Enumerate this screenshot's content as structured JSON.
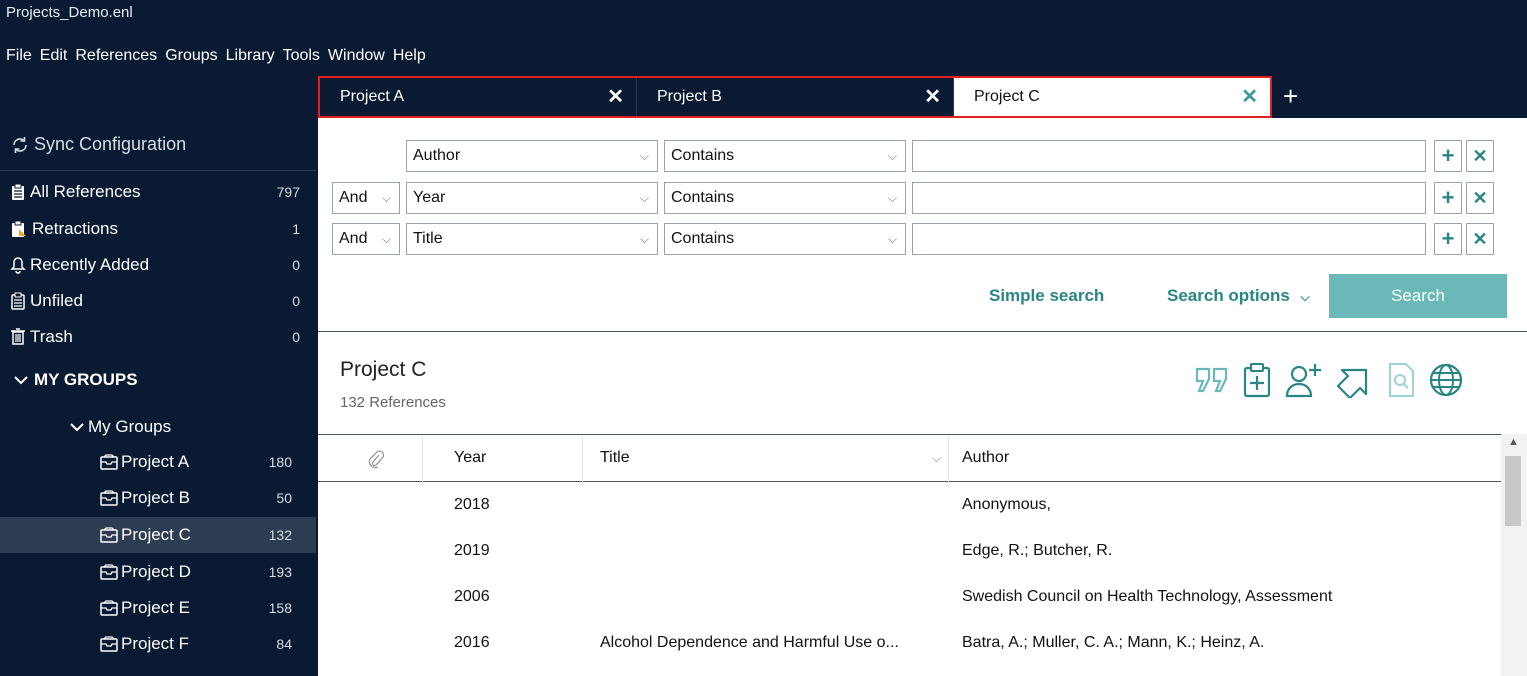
{
  "window": {
    "title": "Projects_Demo.enl"
  },
  "menu": [
    "File",
    "Edit",
    "References",
    "Groups",
    "Library",
    "Tools",
    "Window",
    "Help"
  ],
  "tabs": [
    {
      "label": "Project A",
      "active": false
    },
    {
      "label": "Project B",
      "active": false
    },
    {
      "label": "Project C",
      "active": true
    }
  ],
  "tab_close_glyph": "✕",
  "tab_add_glyph": "+",
  "sidebar": {
    "sync_label": "Sync Configuration",
    "items": [
      {
        "label": "All References",
        "count": "797",
        "icon": "clipboard-icon"
      },
      {
        "label": "Retractions",
        "count": "1",
        "icon": "retraction-icon"
      },
      {
        "label": "Recently Added",
        "count": "0",
        "icon": "bell-icon"
      },
      {
        "label": "Unfiled",
        "count": "0",
        "icon": "clipboard-icon"
      },
      {
        "label": "Trash",
        "count": "0",
        "icon": "trash-icon"
      }
    ],
    "groups_heading": "MY GROUPS",
    "group_set_label": "My Groups",
    "groups": [
      {
        "label": "Project A",
        "count": "180"
      },
      {
        "label": "Project B",
        "count": "50"
      },
      {
        "label": "Project C",
        "count": "132",
        "selected": true
      },
      {
        "label": "Project D",
        "count": "193"
      },
      {
        "label": "Project E",
        "count": "158"
      },
      {
        "label": "Project F",
        "count": "84"
      }
    ]
  },
  "search": {
    "rows": [
      {
        "bool": "",
        "field": "Author",
        "op": "Contains",
        "value": ""
      },
      {
        "bool": "And",
        "field": "Year",
        "op": "Contains",
        "value": ""
      },
      {
        "bool": "And",
        "field": "Title",
        "op": "Contains",
        "value": ""
      }
    ],
    "simple_search_label": "Simple search",
    "options_label": "Search options",
    "search_button": "Search"
  },
  "library": {
    "title": "Project C",
    "count_label": "132 References"
  },
  "table": {
    "headers": {
      "year": "Year",
      "title": "Title",
      "author": "Author"
    },
    "rows": [
      {
        "year": "2018",
        "title": "",
        "author": "Anonymous,"
      },
      {
        "year": "2019",
        "title": "",
        "author": "Edge, R.; Butcher, R."
      },
      {
        "year": "2006",
        "title": "",
        "author": "Swedish Council on Health Technology, Assessment"
      },
      {
        "year": "2016",
        "title": "Alcohol Dependence and Harmful Use o...",
        "author": "Batra, A.; Muller, C. A.; Mann, K.; Heinz, A."
      }
    ]
  },
  "colors": {
    "sidebar_bg": "#0a1a33",
    "accent": "#2a8585",
    "search_button": "#6ab8b8",
    "tab_highlight": "#e02020",
    "selected_row": "#2d3c52"
  }
}
